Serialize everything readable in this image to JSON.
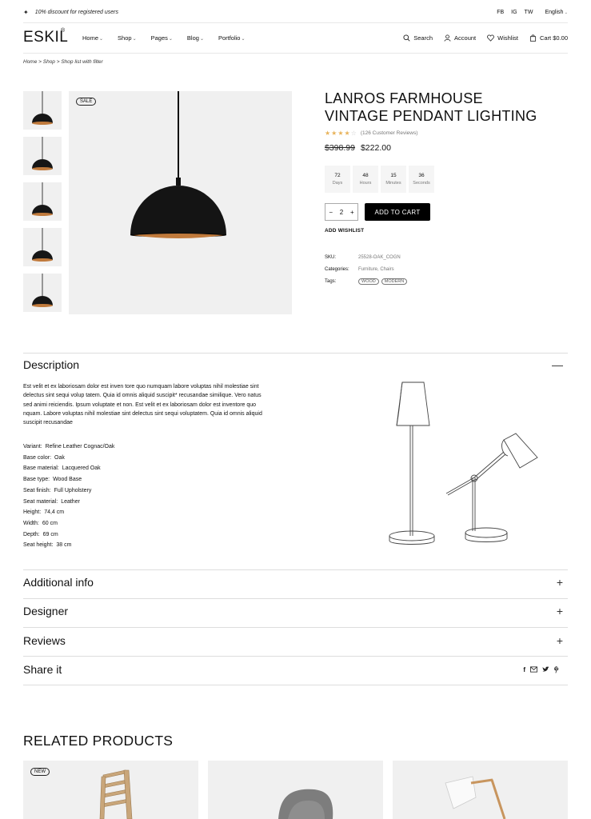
{
  "topbar": {
    "promo": "10% discount for registered users",
    "social": [
      "FB",
      "IG",
      "TW"
    ],
    "language": "English"
  },
  "header": {
    "logo": "ESKIL",
    "logo_mark": "®",
    "nav": [
      "Home",
      "Shop",
      "Pages",
      "Blog",
      "Portfolio"
    ],
    "search": "Search",
    "account": "Account",
    "wishlist": "Wishlist",
    "cart": "Cart $0.00"
  },
  "breadcrumb": "Home > Shop > Shop list with filter",
  "gallery": {
    "sale_badge": "SALE",
    "thumbnail_count": 5
  },
  "product": {
    "title_line1": "LANROS FARMHOUSE",
    "title_line2": "VINTAGE PENDANT LIGHTING",
    "rating": 4,
    "rating_max": 5,
    "reviews": "(126 Customer Reviews)",
    "old_price": "$398.99",
    "price": "$222.00",
    "countdown": [
      {
        "value": "72",
        "unit": "Days"
      },
      {
        "value": "48",
        "unit": "Hours"
      },
      {
        "value": "15",
        "unit": "Minutes"
      },
      {
        "value": "36",
        "unit": "Seconds"
      }
    ],
    "quantity": "2",
    "add_to_cart": "ADD TO CART",
    "add_wishlist": "ADD WISHLIST",
    "sku_label": "SKU:",
    "sku": "25528-OAK_COGN",
    "categories_label": "Categories:",
    "categories": "Furniture, Chairs",
    "tags_label": "Tags:",
    "tags": [
      "WOOD",
      "MODERN"
    ]
  },
  "description": {
    "heading": "Description",
    "text": "Est velit et ex laboriosam dolor est inven tore quo numquam labore voluptas nihil molestiae sint delectus sint sequi volup tatem. Quia id omnis aliquid suscipit* recusandae similique. Vero natus sed animi reiciendis. Ipsum voluptate et non. Est velit et ex laboriosam dolor est inventore quo nquam. Labore voluptas nihil molestiae sint delectus sint sequi voluptatem. Quia id omnis aliquid suscipit recusandae",
    "specs": [
      {
        "k": "Variant:",
        "v": "Refine Leather Cognac/Oak"
      },
      {
        "k": "Base color:",
        "v": "Oak"
      },
      {
        "k": "Base material:",
        "v": "Lacquered Oak"
      },
      {
        "k": "Base type:",
        "v": "Wood Base"
      },
      {
        "k": "Seat finish:",
        "v": "Full Upholstery"
      },
      {
        "k": "Seat material:",
        "v": "Leather"
      },
      {
        "k": "Height:",
        "v": "74,4 cm"
      },
      {
        "k": "Width:",
        "v": "60 cm"
      },
      {
        "k": "Depth:",
        "v": "69 cm"
      },
      {
        "k": "Seat height:",
        "v": "38 cm"
      }
    ]
  },
  "sections": [
    "Additional info",
    "Designer",
    "Reviews",
    "Share it"
  ],
  "related": {
    "title": "RELATED PRODUCTS",
    "new_badge": "NEW"
  },
  "colors": {
    "star": "#e8b35a",
    "image_bg": "#f0f0f0",
    "button_bg": "#000000",
    "lamp_copper": "#c07a3c"
  }
}
